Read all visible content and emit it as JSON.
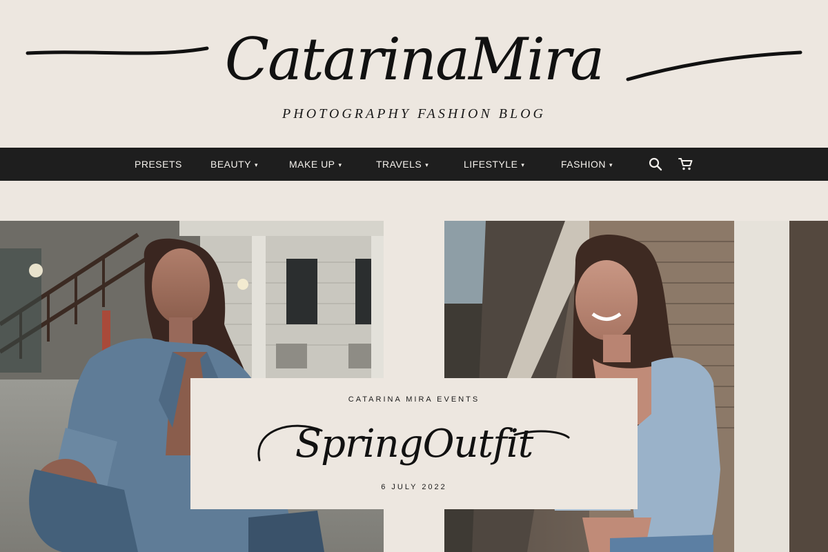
{
  "site": {
    "logo": "CatarinaMira",
    "tagline": "PHOTOGRAPHY FASHION BLOG"
  },
  "nav": {
    "items": [
      {
        "label": "PRESETS",
        "dropdown": false
      },
      {
        "label": "BEAUTY",
        "dropdown": true
      },
      {
        "label": "MAKE UP",
        "dropdown": true
      },
      {
        "label": "TRAVELS",
        "dropdown": true
      },
      {
        "label": "LIFESTYLE",
        "dropdown": true
      },
      {
        "label": "FASHION",
        "dropdown": true
      }
    ],
    "caret": "▾",
    "icons": [
      "search-icon",
      "cart-icon"
    ]
  },
  "photos": [
    {
      "name": "photo-woman-crouching-denim-jacket"
    },
    {
      "name": "photo-woman-smiling-denim-jacket"
    }
  ],
  "feature": {
    "eyebrow": "CATARINA MIRA EVENTS",
    "title": "SpringOutfit",
    "date": "6 JULY 2022"
  },
  "colors": {
    "background": "#ede7e0",
    "navbar": "#1e1e1e",
    "nav_text": "#f4f1ec",
    "ink": "#111111"
  }
}
